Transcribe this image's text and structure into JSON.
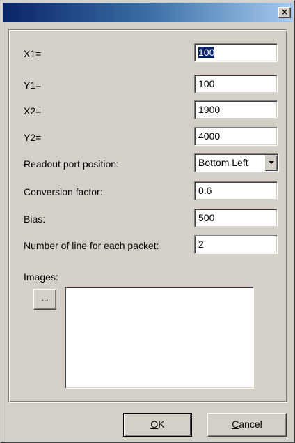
{
  "window": {
    "title": "",
    "close_glyph": "×",
    "colors": {
      "titlebar_start": "#0a246a",
      "titlebar_end": "#a6caf0",
      "face": "#d4d0c8",
      "selection": "#0a246a"
    }
  },
  "form": {
    "fields": [
      {
        "label": "X1=",
        "value": "100",
        "selected": true
      },
      {
        "label": "Y1=",
        "value": "100"
      },
      {
        "label": "X2=",
        "value": "1900"
      },
      {
        "label": "Y2=",
        "value": "4000"
      }
    ],
    "readout": {
      "label": "Readout port position:",
      "value": "Bottom Left"
    },
    "conversion": {
      "label": "Conversion factor:",
      "value": "0.6"
    },
    "bias": {
      "label": "Bias:",
      "value": "500"
    },
    "lines": {
      "label": "Number of line for each packet:",
      "value": "2"
    },
    "images": {
      "label": "Images:",
      "browse_label": "...",
      "items": []
    }
  },
  "buttons": {
    "ok": {
      "accel": "O",
      "rest": "K"
    },
    "cancel": {
      "accel": "C",
      "rest": "ancel"
    }
  },
  "icons": {
    "close": "close-icon",
    "dropdown": "chevron-down-icon"
  }
}
